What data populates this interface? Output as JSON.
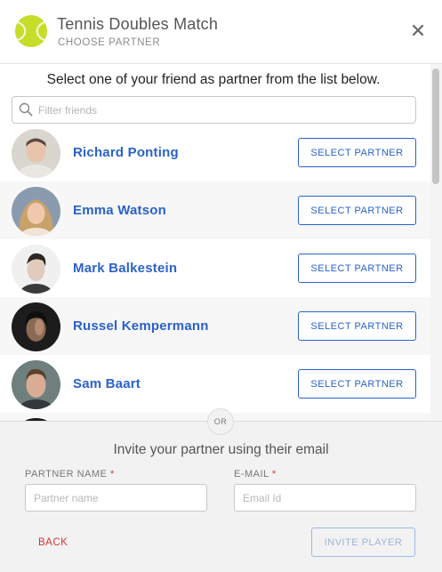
{
  "header": {
    "title": "Tennis Doubles Match",
    "subtitle": "CHOOSE PARTNER",
    "logo_icon": "tennis-ball-icon",
    "close_icon": "close-icon"
  },
  "main": {
    "instruction": "Select one of your friend as partner from the list below.",
    "filter_placeholder": "Filter friends",
    "select_label": "SELECT PARTNER",
    "friends": [
      {
        "name": "Richard Ponting"
      },
      {
        "name": "Emma Watson"
      },
      {
        "name": "Mark Balkestein"
      },
      {
        "name": "Russel Kempermann"
      },
      {
        "name": "Sam Baart"
      }
    ]
  },
  "invite": {
    "or_label": "OR",
    "title": "Invite your partner using their email",
    "partner_name_label": "PARTNER NAME",
    "partner_name_placeholder": "Partner name",
    "email_label": "E-MAIL",
    "email_placeholder": "Email Id",
    "required_marker": "*",
    "back_label": "BACK",
    "invite_label": "INVITE PLAYER"
  },
  "colors": {
    "accent": "#2a62c9",
    "danger": "#d9342b",
    "logo": "#c6dd2a"
  }
}
